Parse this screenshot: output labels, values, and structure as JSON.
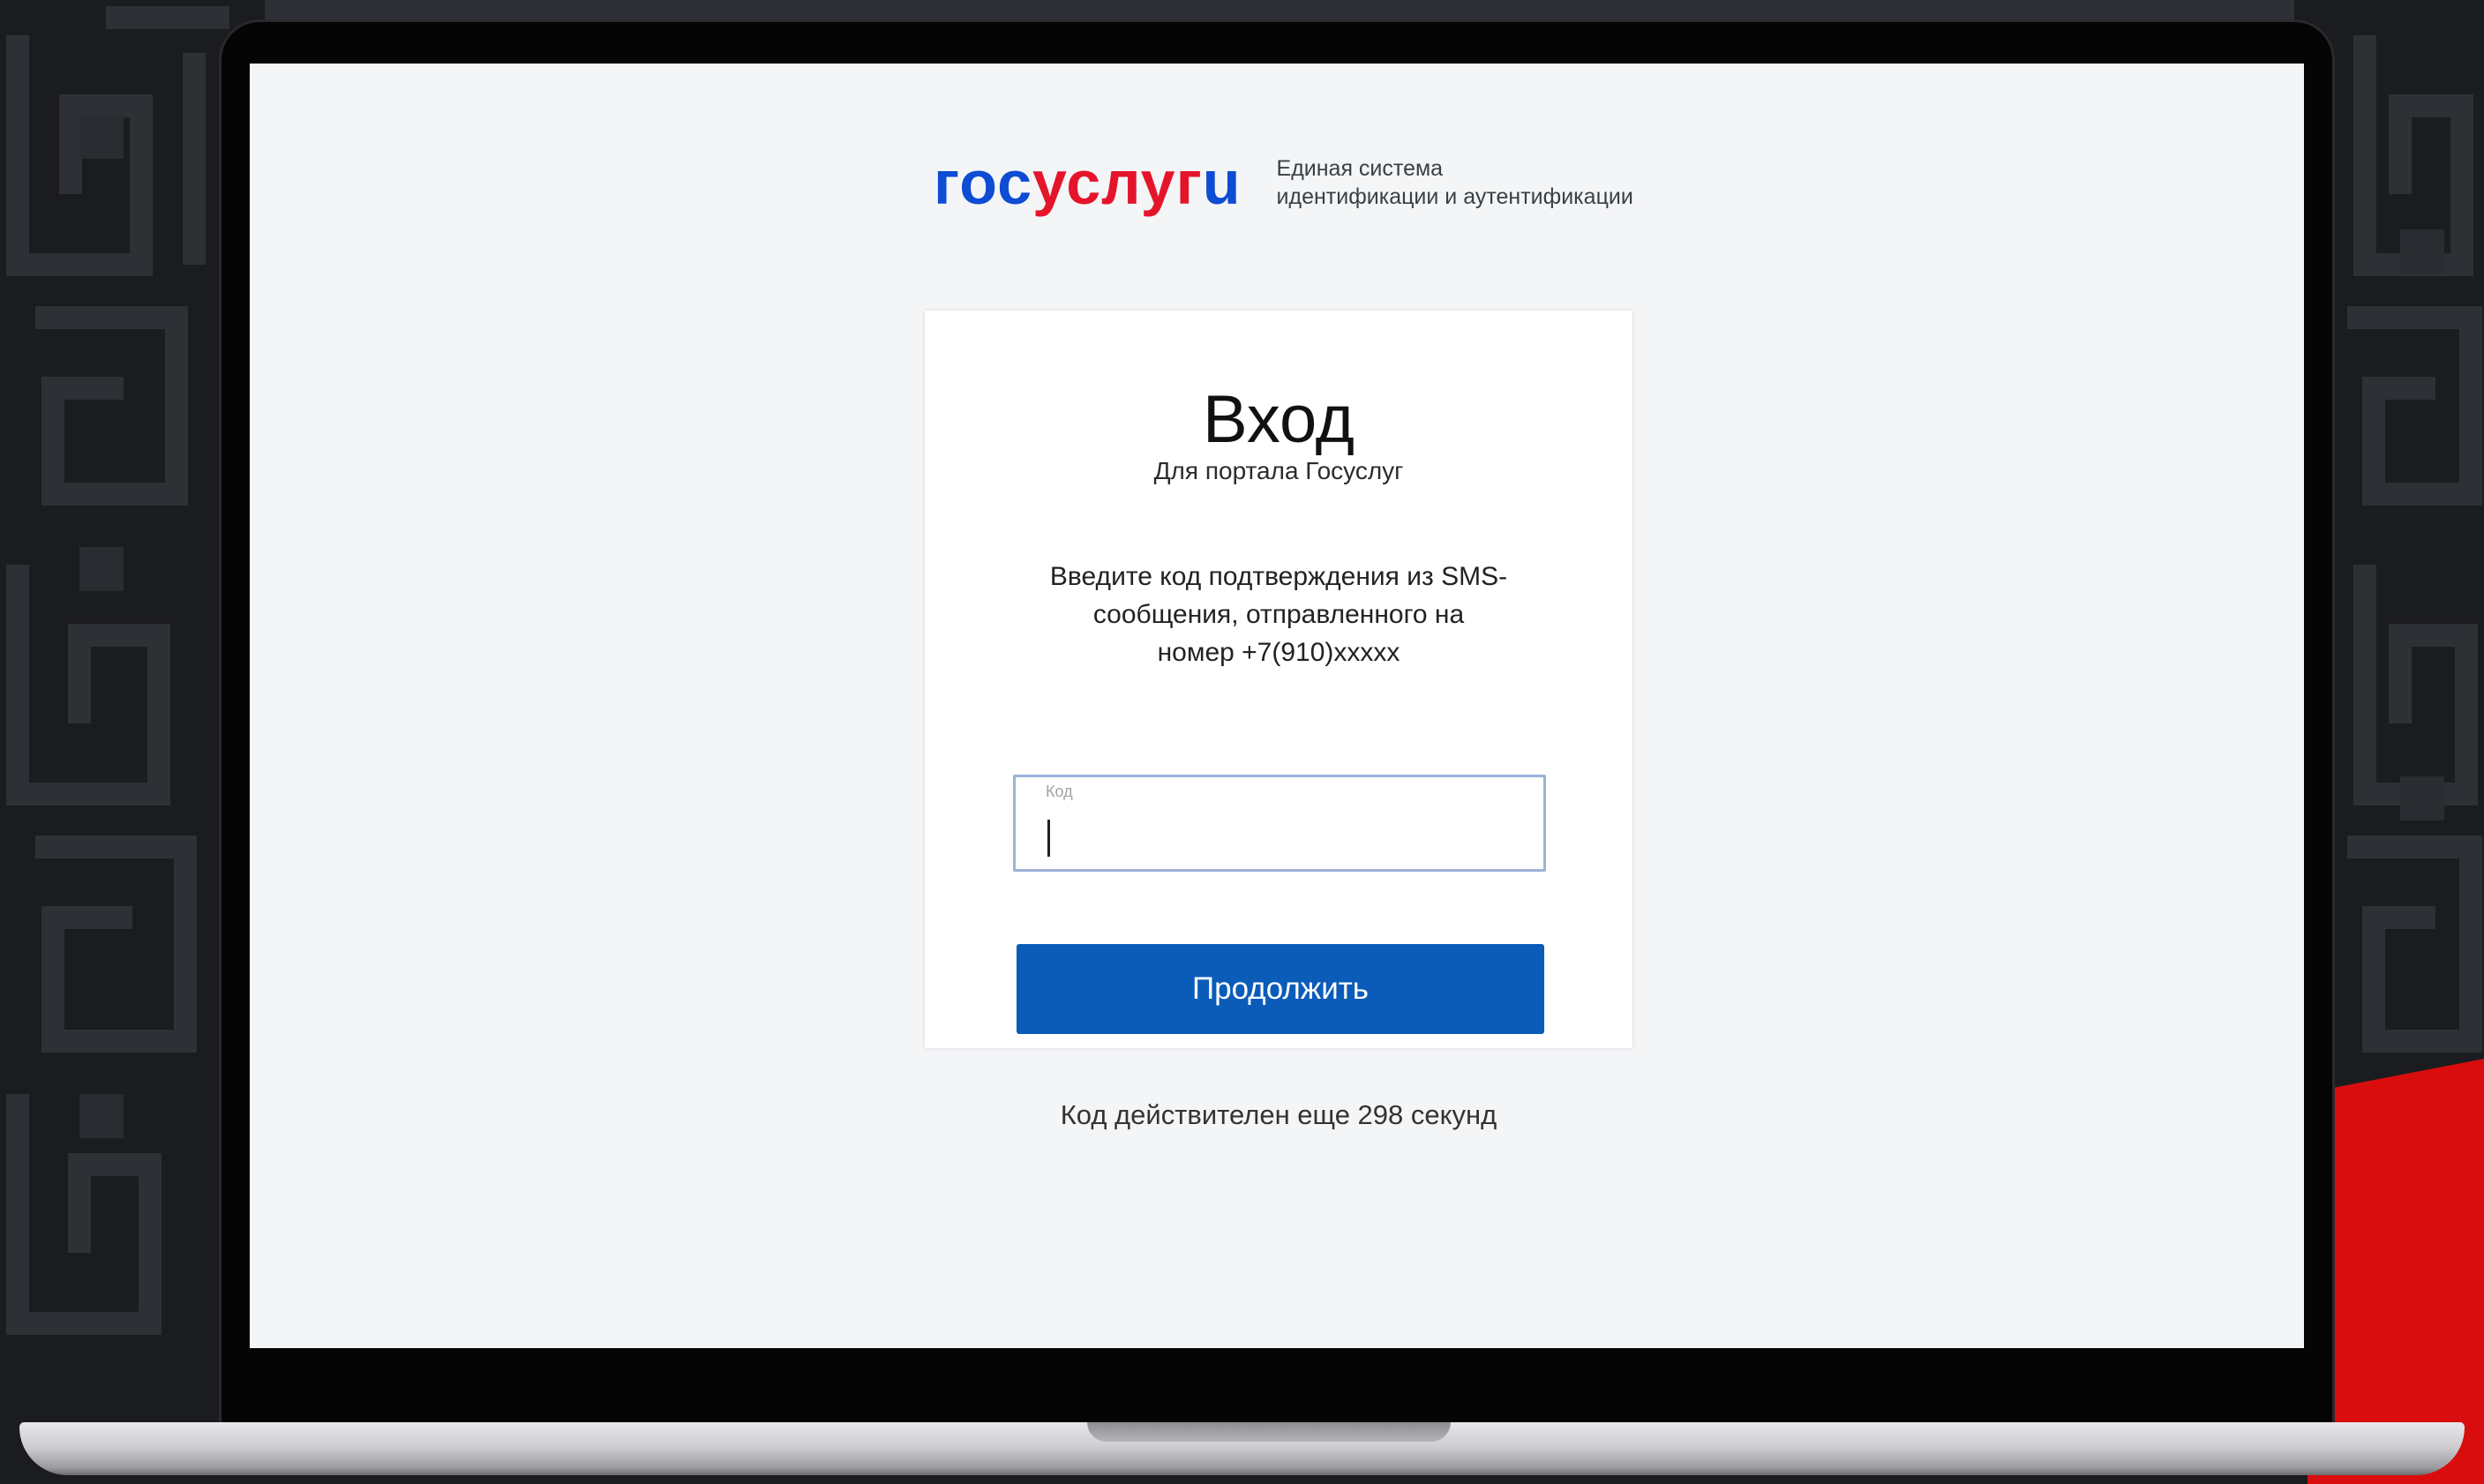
{
  "brand": {
    "logo_part1": "гос",
    "logo_part2": "услуг",
    "logo_part3": "u",
    "caption_line1": "Единая система",
    "caption_line2": "идентификации и аутентификации",
    "color_blue": "#0d4cd3",
    "color_red": "#e4152b"
  },
  "login_card": {
    "title": "Вход",
    "subtitle": "Для портала Госуслуг",
    "instructions": [
      "Введите код подтверждения из SMS-",
      "сообщения, отправленного на",
      "номер +7(910)xxxxx"
    ],
    "code_field": {
      "label": "Код",
      "value": ""
    },
    "continue_button": "Продолжить",
    "button_color": "#0b5cb8"
  },
  "timer": {
    "text": "Код действителен еще 298 секунд"
  },
  "frame": {
    "device": "laptop",
    "accent_color": "#d90d0d"
  }
}
